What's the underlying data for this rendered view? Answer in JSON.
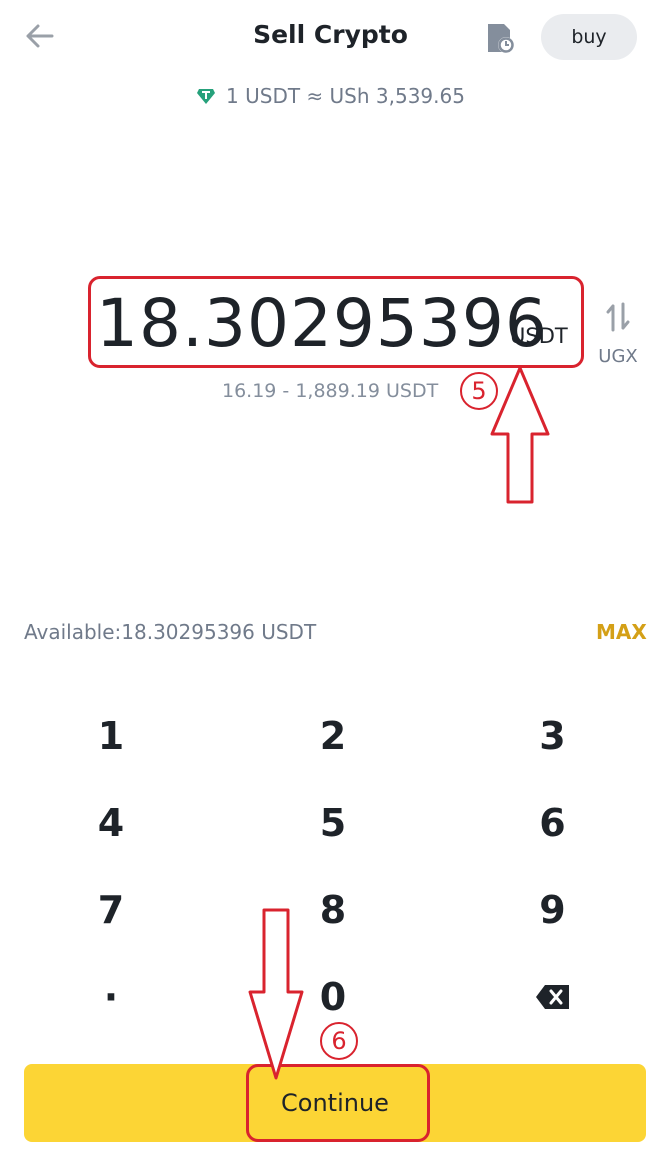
{
  "header": {
    "title": "Sell Crypto",
    "buy_label": "buy"
  },
  "rate": {
    "text": "1 USDT ≈ USh  3,539.65"
  },
  "amount": {
    "value": "18.30295396",
    "unit": "USDT",
    "swap_label": "UGX"
  },
  "range": {
    "text": "16.19 - 1,889.19 USDT"
  },
  "available": {
    "text": "Available:18.30295396 USDT",
    "max_label": "MAX"
  },
  "keypad": {
    "keys": [
      "1",
      "2",
      "3",
      "4",
      "5",
      "6",
      "7",
      "8",
      "9",
      "·",
      "0"
    ]
  },
  "continue": {
    "label": "Continue"
  },
  "annotations": {
    "step5": "5",
    "step6": "6"
  },
  "colors": {
    "accent": "#fcd535",
    "max": "#d4a017",
    "annotation": "#d9232e",
    "tether": "#26a17b"
  }
}
